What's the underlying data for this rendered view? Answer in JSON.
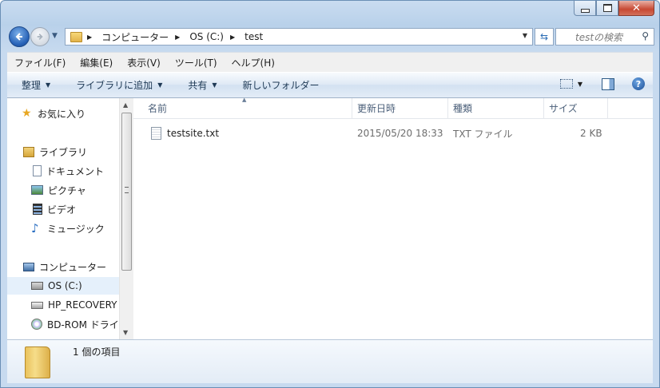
{
  "window": {
    "caption_buttons": [
      "minimize",
      "maximize",
      "close"
    ]
  },
  "address_bar": {
    "breadcrumbs": [
      "コンピューター",
      "OS (C:)",
      "test"
    ]
  },
  "search": {
    "placeholder": "testの検索"
  },
  "menu": {
    "items": [
      "ファイル(F)",
      "編集(E)",
      "表示(V)",
      "ツール(T)",
      "ヘルプ(H)"
    ]
  },
  "toolbar": {
    "organize": "整理",
    "add_to_library": "ライブラリに追加",
    "share": "共有",
    "new_folder": "新しいフォルダー"
  },
  "nav_pane": {
    "favorites": "お気に入り",
    "libraries": "ライブラリ",
    "documents": "ドキュメント",
    "pictures": "ピクチャ",
    "videos": "ビデオ",
    "music": "ミュージック",
    "computer": "コンピューター",
    "os_drive": "OS (C:)",
    "recovery_drive": "HP_RECOVERY",
    "bd_drive": "BD-ROM ドライ"
  },
  "columns": {
    "name": "名前",
    "modified": "更新日時",
    "type": "種類",
    "size": "サイズ"
  },
  "files": [
    {
      "name": "testsite.txt",
      "modified": "2015/05/20 18:33",
      "type": "TXT ファイル",
      "size": "2 KB"
    }
  ],
  "status": {
    "count": "1 個の項目"
  },
  "colors": {
    "window_frame": "#b9d1ea",
    "selection": "#e5f0fb",
    "header_text": "#4c607a"
  }
}
